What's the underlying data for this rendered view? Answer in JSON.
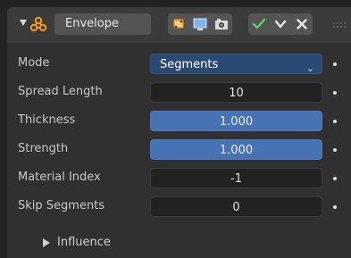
{
  "header": {
    "modifier_name": "Envelope",
    "icons": {
      "collapse": "chevron-down-icon",
      "modifier": "envelope-modifier-icon",
      "editmode": "edit-mode-icon",
      "viewport": "viewport-display-icon",
      "render": "render-icon",
      "apply": "apply-checkmark-icon",
      "menu": "chevron-down-menu-icon",
      "delete": "close-icon",
      "drag": "drag-handle-icon"
    },
    "colors": {
      "apply_check": "#5fd35f",
      "modifier_icon": "#f39c1c"
    }
  },
  "rows": {
    "mode": {
      "label": "Mode",
      "value": "Segments"
    },
    "spread_length": {
      "label": "Spread Length",
      "value": "10"
    },
    "thickness": {
      "label": "Thickness",
      "value": "1.000"
    },
    "strength": {
      "label": "Strength",
      "value": "1.000"
    },
    "material_index": {
      "label": "Material Index",
      "value": "-1"
    },
    "skip_segments": {
      "label": "Skip Segments",
      "value": "0"
    }
  },
  "influence": {
    "label": "Influence"
  },
  "colors": {
    "slider_fill": "#4772b3",
    "dropdown_bg": "#2b4a73",
    "panel_bg": "#303030"
  }
}
